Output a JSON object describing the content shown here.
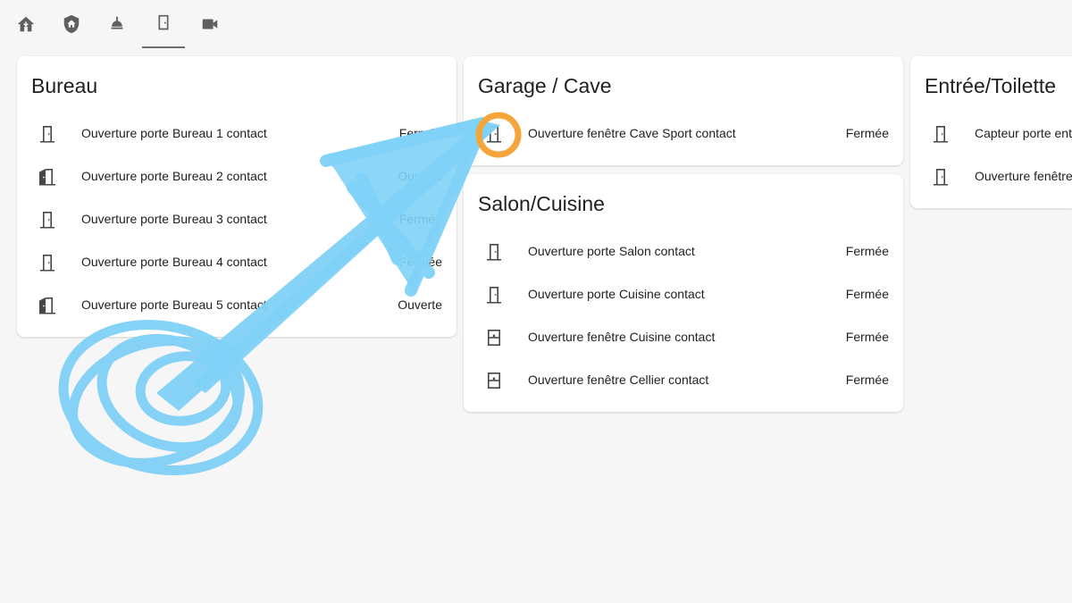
{
  "nav": {
    "tabs": [
      {
        "name": "home-icon"
      },
      {
        "name": "shield-home-icon"
      },
      {
        "name": "ceiling-light-icon"
      },
      {
        "name": "door-icon"
      },
      {
        "name": "video-camera-icon"
      }
    ],
    "active_tab": "door-icon"
  },
  "cards": {
    "bureau": {
      "title": "Bureau",
      "rows": [
        {
          "icon": "door-closed-icon",
          "name": "Ouverture porte Bureau 1 contact",
          "state": "Fermée"
        },
        {
          "icon": "door-open-icon",
          "name": "Ouverture porte Bureau 2 contact",
          "state": "Ouverte"
        },
        {
          "icon": "door-closed-icon",
          "name": "Ouverture porte Bureau 3 contact",
          "state": "Fermée"
        },
        {
          "icon": "door-closed-icon",
          "name": "Ouverture porte Bureau 4 contact",
          "state": "Fermée"
        },
        {
          "icon": "door-open-icon",
          "name": "Ouverture porte Bureau 5 contact",
          "state": "Ouverte"
        }
      ]
    },
    "garage": {
      "title": "Garage / Cave",
      "rows": [
        {
          "icon": "door-closed-icon",
          "name": "Ouverture fenêtre Cave Sport contact",
          "state": "Fermée"
        }
      ]
    },
    "salon": {
      "title": "Salon/Cuisine",
      "rows": [
        {
          "icon": "door-closed-icon",
          "name": "Ouverture porte Salon contact",
          "state": "Fermée"
        },
        {
          "icon": "door-closed-icon",
          "name": "Ouverture porte Cuisine contact",
          "state": "Fermée"
        },
        {
          "icon": "window-closed-icon",
          "name": "Ouverture fenêtre Cuisine contact",
          "state": "Fermée"
        },
        {
          "icon": "window-closed-icon",
          "name": "Ouverture fenêtre Cellier contact",
          "state": "Fermée"
        }
      ]
    },
    "entree": {
      "title": "Entrée/Toilette",
      "rows": [
        {
          "icon": "door-closed-icon",
          "name": "Capteur porte entrée",
          "state": ""
        },
        {
          "icon": "door-closed-icon",
          "name": "Ouverture fenêtre",
          "state": ""
        }
      ]
    }
  },
  "annotation": {
    "arrow_color": "#7fd1f7",
    "highlight_color": "#f5a63a"
  }
}
